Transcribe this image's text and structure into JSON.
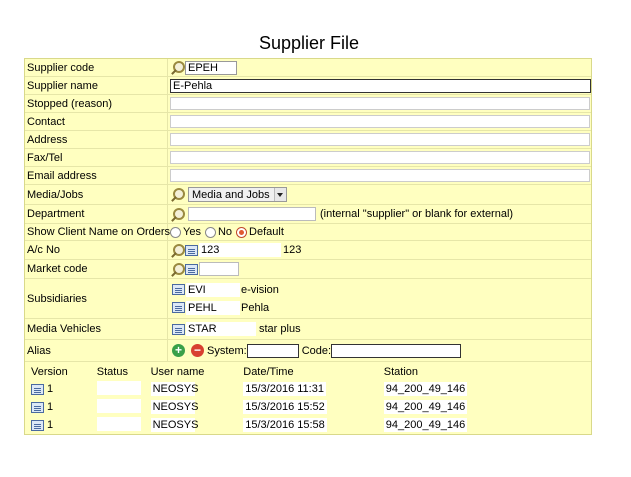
{
  "page": {
    "title": "Supplier File"
  },
  "fields": {
    "supplier_code": {
      "label": "Supplier code",
      "value": "EPEH"
    },
    "supplier_name": {
      "label": "Supplier name",
      "value": "E-Pehla"
    },
    "stopped": {
      "label": "Stopped (reason)",
      "value": ""
    },
    "contact": {
      "label": "Contact",
      "value": ""
    },
    "address": {
      "label": "Address",
      "value": ""
    },
    "fax_tel": {
      "label": "Fax/Tel",
      "value": ""
    },
    "email": {
      "label": "Email address",
      "value": ""
    },
    "media_jobs": {
      "label": "Media/Jobs",
      "value": "Media and Jobs"
    },
    "department": {
      "label": "Department",
      "value": "",
      "hint": "(internal \"supplier\" or blank for external)"
    },
    "show_client": {
      "label": "Show Client Name on Orders",
      "options": [
        "Yes",
        "No",
        "Default"
      ],
      "selected": "Default"
    },
    "ac_no": {
      "label": "A/c No",
      "value": "123",
      "display": "123"
    },
    "market_code": {
      "label": "Market code",
      "value": ""
    },
    "subsidiaries": {
      "label": "Subsidiaries",
      "items": [
        {
          "code": "EVI",
          "name": "e-vision"
        },
        {
          "code": "PEHL",
          "name": "Pehla"
        }
      ]
    },
    "media_vehicles": {
      "label": "Media Vehicles",
      "items": [
        {
          "code": "STAR",
          "name": "star plus"
        }
      ]
    },
    "alias": {
      "label": "Alias",
      "system_label": "System:",
      "system_value": "",
      "code_label": "Code:",
      "code_value": ""
    }
  },
  "versions": {
    "headers": [
      "Version",
      "Status",
      "User name",
      "Date/Time",
      "Station"
    ],
    "rows": [
      {
        "version": "1",
        "status": "",
        "user": "NEOSYS",
        "datetime": "15/3/2016 11:31",
        "station": "94_200_49_146"
      },
      {
        "version": "1",
        "status": "",
        "user": "NEOSYS",
        "datetime": "15/3/2016 15:52",
        "station": "94_200_49_146"
      },
      {
        "version": "1",
        "status": "",
        "user": "NEOSYS",
        "datetime": "15/3/2016 15:58",
        "station": "94_200_49_146"
      }
    ]
  },
  "icons": {
    "search": "magnifier-icon",
    "record": "record-card-icon",
    "add": "plus-icon",
    "remove": "minus-icon"
  },
  "colors": {
    "form_bg": "#ffffc0",
    "border": "#d9d98a"
  }
}
